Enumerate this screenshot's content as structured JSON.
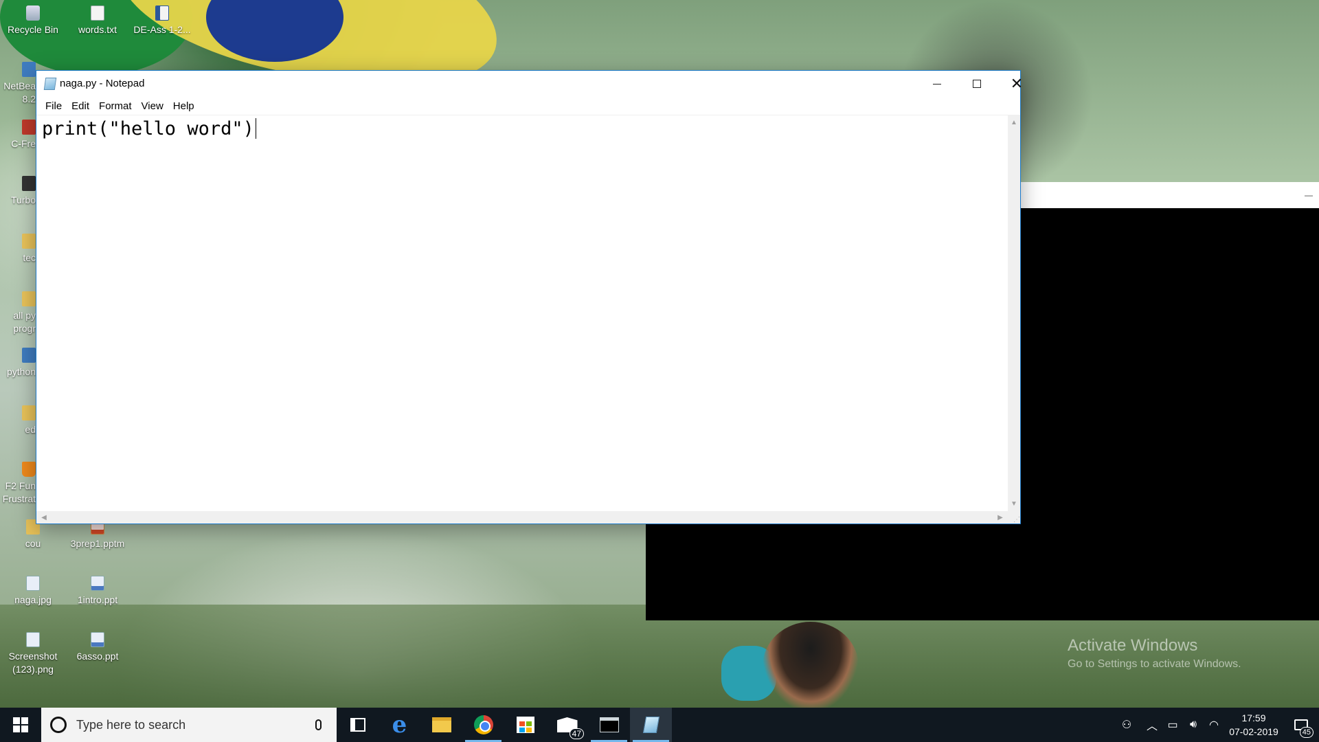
{
  "desktop": {
    "icons": [
      {
        "label": "Recycle Bin",
        "icon": "recycle-bin-icon"
      },
      {
        "label": "words.txt",
        "icon": "text-file-icon"
      },
      {
        "label": "DE-Ass 1-2...",
        "icon": "word-document-icon"
      },
      {
        "label": "NetBea 8.2",
        "icon": "netbeans-icon"
      },
      {
        "label": "C-Fre",
        "icon": "c-free-icon"
      },
      {
        "label": "Turbo",
        "icon": "turbo-c-icon"
      },
      {
        "label": "tec",
        "icon": "folder-icon"
      },
      {
        "label": "all py progr",
        "icon": "folder-icon"
      },
      {
        "label": "python",
        "icon": "python-icon"
      },
      {
        "label": "ed",
        "icon": "folder-icon"
      },
      {
        "label": "F2 Fun Frustrat",
        "icon": "vlc-icon"
      },
      {
        "label": "cou",
        "icon": "folder-icon"
      },
      {
        "label": "3prep1.pptm",
        "icon": "powerpoint-macro-icon"
      },
      {
        "label": "naga.jpg",
        "icon": "image-file-icon"
      },
      {
        "label": "1intro.ppt",
        "icon": "powerpoint-icon"
      },
      {
        "label": "Screenshot (123).png",
        "icon": "image-file-icon"
      },
      {
        "label": "6asso.ppt",
        "icon": "powerpoint-icon"
      }
    ],
    "watermark": {
      "title": "Activate Windows",
      "subtitle": "Go to Settings to activate Windows."
    }
  },
  "notepad": {
    "title": "naga.py - Notepad",
    "menu": [
      "File",
      "Edit",
      "Format",
      "View",
      "Help"
    ],
    "content": "print(\"hello word\")",
    "controls": {
      "minimize": "minimize",
      "maximize": "maximize",
      "close": "close"
    }
  },
  "taskbar": {
    "search_placeholder": "Type here to search",
    "apps": [
      {
        "name": "Task View",
        "icon": "task-view-icon"
      },
      {
        "name": "Microsoft Edge",
        "icon": "edge-icon"
      },
      {
        "name": "File Explorer",
        "icon": "file-explorer-icon"
      },
      {
        "name": "Google Chrome",
        "icon": "chrome-icon"
      },
      {
        "name": "Microsoft Store",
        "icon": "store-icon"
      },
      {
        "name": "Mail",
        "icon": "mail-icon",
        "badge": "47"
      },
      {
        "name": "Command Prompt",
        "icon": "command-prompt-icon"
      },
      {
        "name": "Notepad",
        "icon": "notepad-icon"
      }
    ],
    "clock": {
      "time": "17:59",
      "date": "07-02-2019"
    },
    "notifications_badge": "45"
  },
  "colors": {
    "taskbar": "#101820",
    "accent": "#76b9ed",
    "window_border": "#1979ca"
  }
}
